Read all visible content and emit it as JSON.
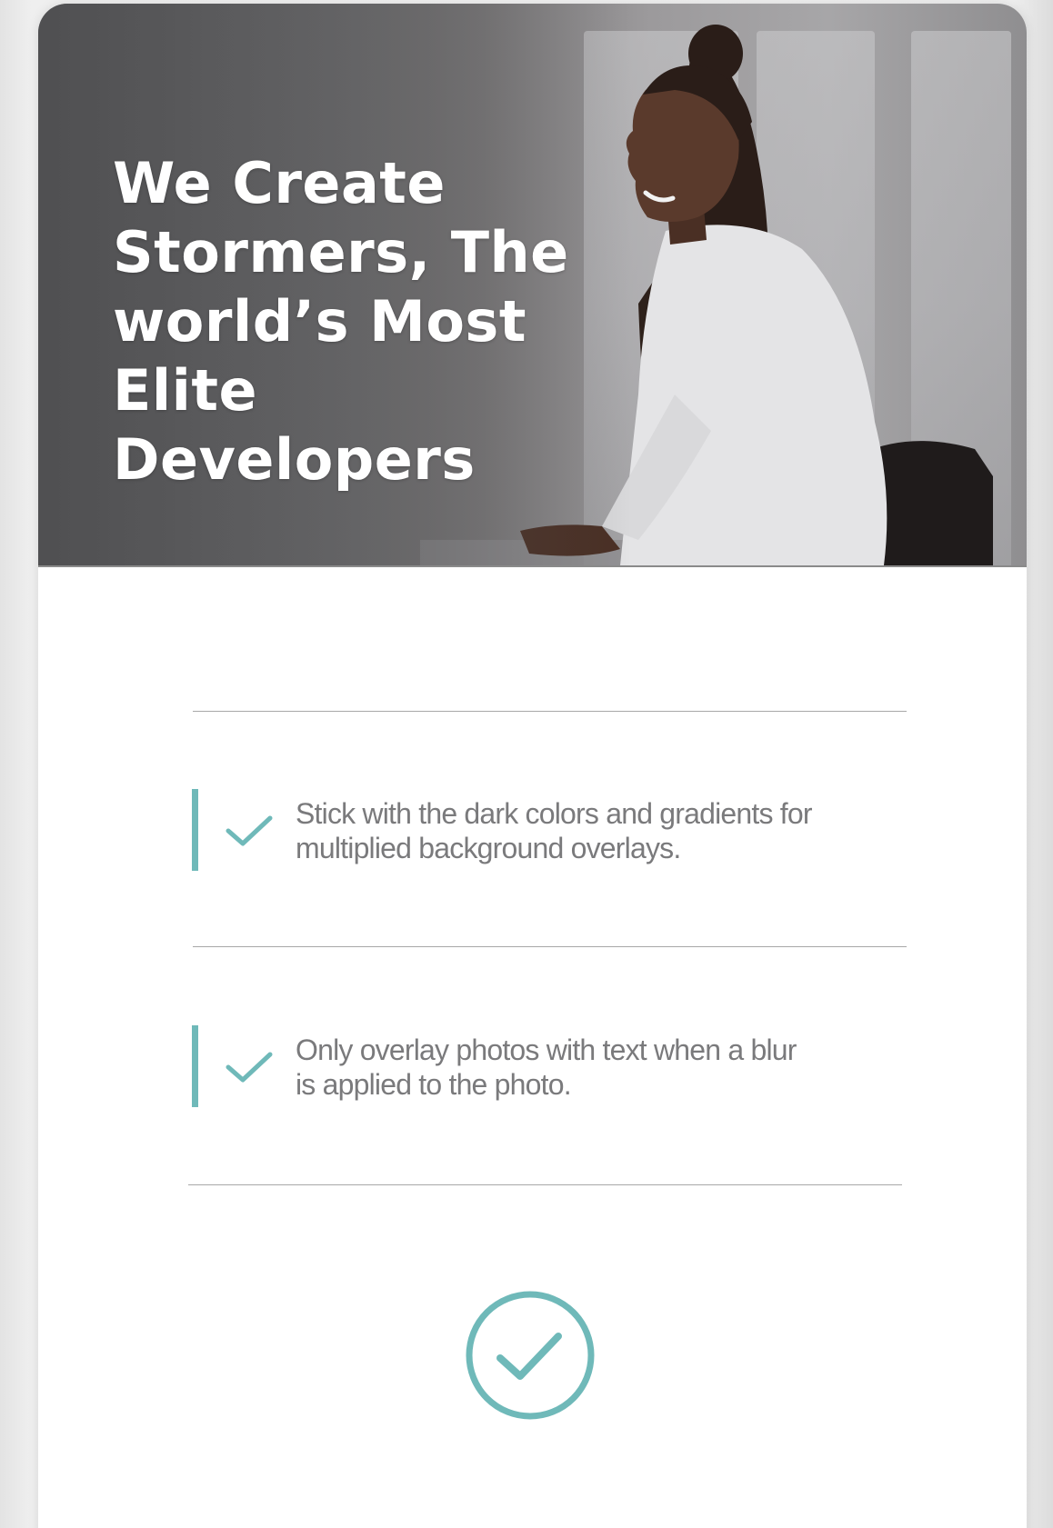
{
  "hero": {
    "title_lines": [
      "We Create",
      "Stormers, The",
      "world’s Most",
      "Elite Developers"
    ],
    "photo_icon": "person-at-desk-illustration"
  },
  "features": [
    {
      "icon": "check-icon",
      "lines": [
        "Stick with the dark colors and gradients for",
        "multiplied background  overlays."
      ]
    },
    {
      "icon": "check-icon",
      "lines": [
        "Only overlay photos with text when a blur",
        "is  applied to the photo."
      ]
    }
  ],
  "confirm": {
    "icon": "check-circle-icon"
  },
  "colors": {
    "accent": "#6fb9b9",
    "text_muted": "#7a7a7c",
    "divider": "#a8a8a8",
    "hero_text": "#ffffff"
  }
}
